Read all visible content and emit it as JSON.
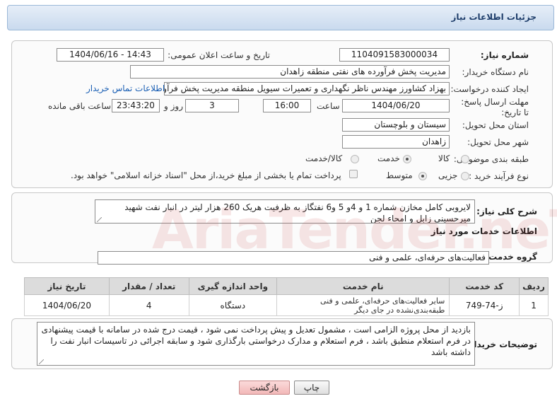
{
  "header": {
    "title": "جزئیات اطلاعات نیاز"
  },
  "fields": {
    "need_number": {
      "label": "شماره نیاز:",
      "value": "1104091583000034"
    },
    "announce_datetime": {
      "label": "تاریخ و ساعت اعلان عمومی:",
      "value": "1404/06/16 - 14:43"
    },
    "buyer_org": {
      "label": "نام دستگاه خریدار:",
      "value": "مدیریت پخش فرآورده های نفتی منطقه زاهدان"
    },
    "requester": {
      "label": "ایجاد کننده درخواست:",
      "value": "بهزاد کشاورز مهندس ناظر نگهداری و تعمیرات سیویل منطقه  مدیریت پخش فرآور",
      "contact_link": "اطلاعات تماس خریدار"
    },
    "deadline": {
      "label": "مهلت ارسال پاسخ: تا تاریخ:",
      "date": "1404/06/20",
      "time_label": "ساعت",
      "time": "16:00",
      "days": "3",
      "days_label": "روز و",
      "remaining": "23:43:20",
      "remaining_label": "ساعت باقی مانده"
    },
    "province": {
      "label": "استان محل تحویل:",
      "value": "سیستان و بلوچستان"
    },
    "city": {
      "label": "شهر محل تحویل:",
      "value": "زاهدان"
    },
    "category": {
      "label": "طبقه بندی موضوعی:",
      "options": [
        "کالا",
        "خدمت",
        "کالا/خدمت"
      ],
      "selected": "خدمت"
    },
    "purchase_type": {
      "label": "نوع فرآیند خرید :",
      "options": [
        "جزیی",
        "متوسط"
      ],
      "selected": "متوسط",
      "note": "پرداخت تمام یا بخشی از مبلغ خرید،از محل \"اسناد خزانه اسلامی\" خواهد بود."
    }
  },
  "description": {
    "label": "شرح کلی نیاز:",
    "text": "لایروبی کامل مخازن شماره 1 و 4و 5 و6 نفتگاز به ظرفیت  هریک 260 هزار لیتر در انبار نفت شهید میرحسینی زابل و امحاء لجن"
  },
  "services": {
    "section_title": "اطلاعات خدمات مورد نیاز",
    "group_label": "گروه خدمت:",
    "group_value": "فعالیت‌های حرفه‌ای، علمی و فنی",
    "columns": [
      "ردیف",
      "کد خدمت",
      "نام خدمت",
      "واحد اندازه گیری",
      "تعداد / مقدار",
      "تاریخ نیاز"
    ],
    "rows": [
      {
        "row": "1",
        "code": "ز-74-749",
        "name": "سایر فعالیت‌های حرفه‌ای، علمی و فنی طبقه‌بندی‌نشده در جای دیگر",
        "unit": "دستگاه",
        "qty": "4",
        "date": "1404/06/20"
      }
    ]
  },
  "buyer_notes": {
    "label": "توضیحات خریدار:",
    "text": "بازدید از محل پروژه الزامی است ، مشمول تعدیل و پیش پرداخت نمی شود ، قیمت درج شده در سامانه با قیمت پیشنهادی در فرم استعلام منطبق باشد ، فرم استعلام و مدارک درخواستی بارگذاری شود و سابقه اجرائی در تاسیسات انبار نفت را داشته باشد"
  },
  "buttons": {
    "print": "چاپ",
    "back": "بازگشت"
  },
  "watermark": "AriaTender.neT"
}
